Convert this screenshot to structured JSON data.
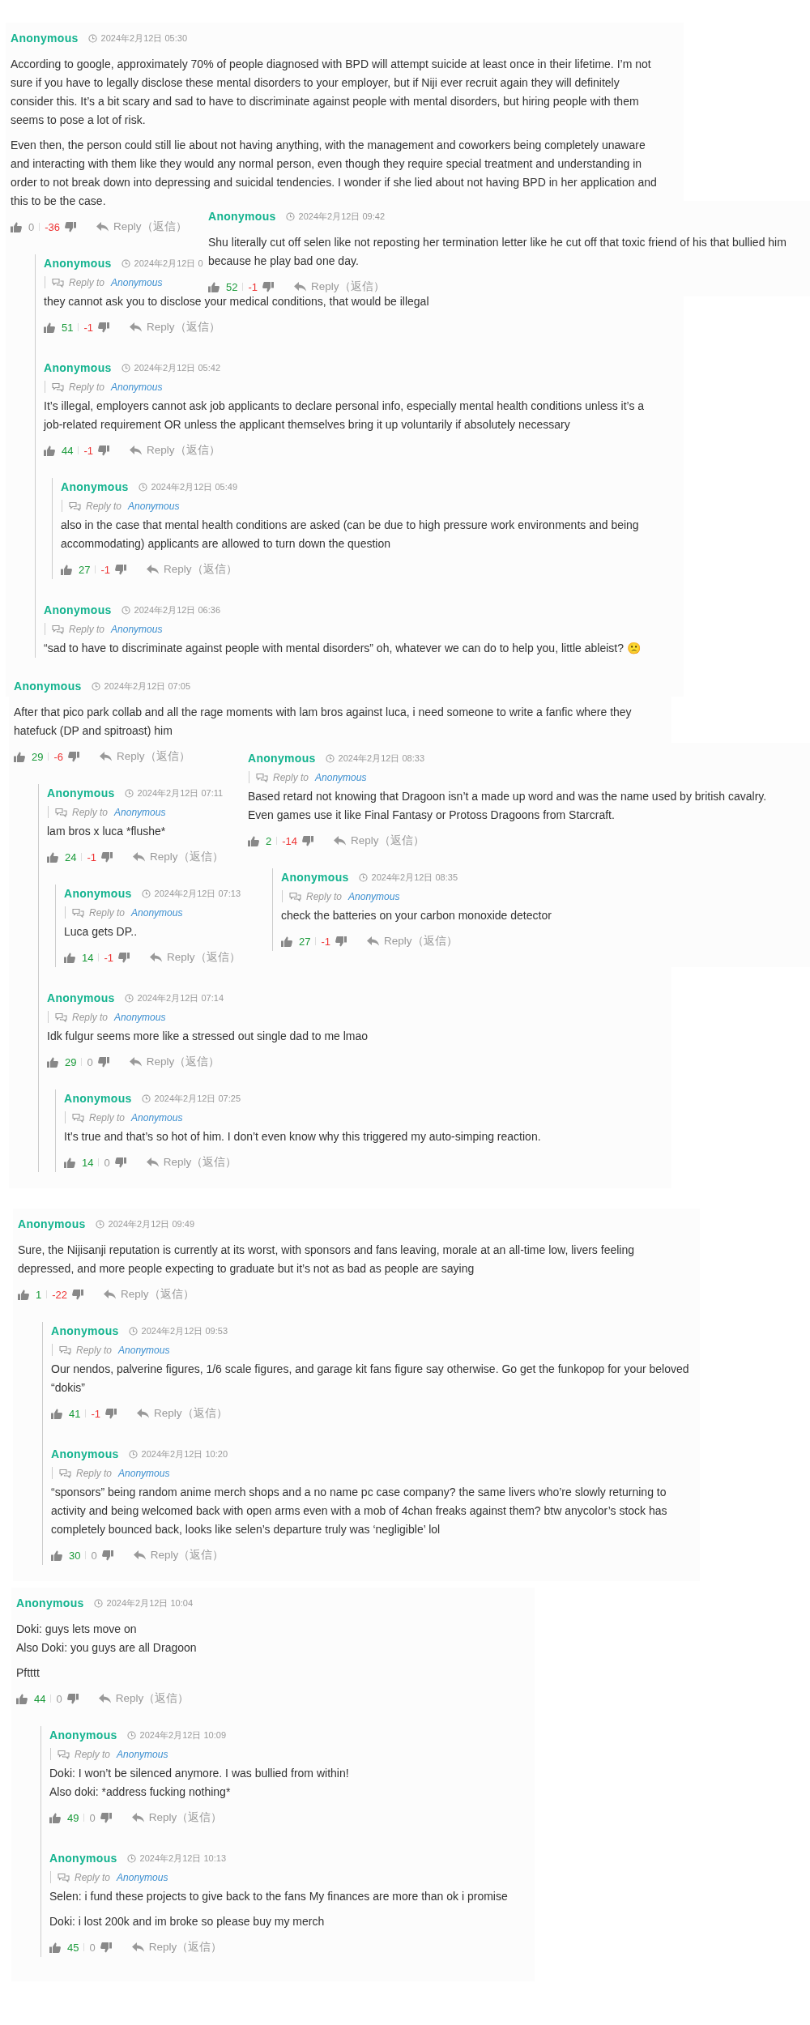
{
  "snippets": [
    {
      "comments": [
        {
          "author": "Anonymous",
          "time": "2024年2月12日 05:30",
          "paragraphs": [
            "According to google, approximately 70% of people diagnosed with BPD will attempt suicide at least once in their lifetime. I’m not sure if you have to legally disclose these mental disorders to your employer, but if Niji ever recruit again they will definitely consider this. It’s a bit scary and sad to have to discriminate against people with mental disorders, but hiring people with them seems to pose a lot of risk.",
            "Even then, the person could still lie about not having anything, with the management and coworkers being completely unaware and interacting with them like they would any normal person, even though they require special treatment and understanding in order to not break down into depressing and suicidal tendencies. I wonder if she lied about not having BPD in her application and this to be the case."
          ],
          "likes": "0",
          "dislikes": "-36",
          "reply_label": "Reply（返信）",
          "replies": [
            {
              "author": "Anonymous",
              "time": "2024年2月12日 0",
              "reply_to_label": "Reply to",
              "reply_to": "Anonymous",
              "paragraphs": [
                "they cannot ask you to disclose your medical conditions, that would be illegal"
              ],
              "likes": "51",
              "dislikes": "-1",
              "reply_label": "Reply（返信）"
            },
            {
              "author": "Anonymous",
              "time": "2024年2月12日 05:42",
              "reply_to_label": "Reply to",
              "reply_to": "Anonymous",
              "paragraphs": [
                "It’s illegal, employers cannot ask job applicants to declare personal info, especially mental health conditions unless it’s a job-related requirement OR unless the applicant themselves bring it up voluntarily if absolutely necessary"
              ],
              "likes": "44",
              "dislikes": "-1",
              "reply_label": "Reply（返信）",
              "replies": [
                {
                  "author": "Anonymous",
                  "time": "2024年2月12日 05:49",
                  "reply_to_label": "Reply to",
                  "reply_to": "Anonymous",
                  "paragraphs": [
                    "also in the case that mental health conditions are asked (can be due to high pressure work environments and being accommodating) applicants are allowed to turn down the question"
                  ],
                  "likes": "27",
                  "dislikes": "-1",
                  "reply_label": "Reply（返信）"
                }
              ]
            },
            {
              "author": "Anonymous",
              "time": "2024年2月12日 06:36",
              "reply_to_label": "Reply to",
              "reply_to": "Anonymous",
              "paragraphs": [
                "“sad to have to discriminate against people with mental disorders” oh, whatever we can do to help you, little ableist? 🙁"
              ]
            }
          ]
        }
      ]
    },
    {
      "comments": [
        {
          "author": "Anonymous",
          "time": "2024年2月12日 09:42",
          "paragraphs": [
            "Shu literally cut off selen like not reposting her termination letter like he cut off that toxic friend of his that bullied him because he play bad one day."
          ],
          "likes": "52",
          "dislikes": "-1",
          "reply_label": "Reply（返信）"
        }
      ]
    },
    {
      "comments": [
        {
          "author": "Anonymous",
          "time": "2024年2月12日 07:05",
          "paragraphs": [
            "After that pico park collab and all the rage moments with lam bros against luca, i need someone to write a fanfic where they hatefuck (DP and spitroast) him"
          ],
          "likes": "29",
          "dislikes": "-6",
          "reply_label": "Reply（返信）",
          "replies": [
            {
              "author": "Anonymous",
              "time": "2024年2月12日 07:11",
              "reply_to_label": "Reply to",
              "reply_to": "Anonymous",
              "paragraphs": [
                "lam bros x luca *flushe*"
              ],
              "likes": "24",
              "dislikes": "-1",
              "reply_label": "Reply（返信）",
              "replies": [
                {
                  "author": "Anonymous",
                  "time": "2024年2月12日 07:13",
                  "reply_to_label": "Reply to",
                  "reply_to": "Anonymous",
                  "paragraphs": [
                    "Luca gets DP.."
                  ],
                  "likes": "14",
                  "dislikes": "-1",
                  "reply_label": "Reply（返信）"
                }
              ]
            },
            {
              "author": "Anonymous",
              "time": "2024年2月12日 07:14",
              "reply_to_label": "Reply to",
              "reply_to": "Anonymous",
              "paragraphs": [
                "Idk fulgur seems more like a stressed out single dad to me lmao"
              ],
              "likes": "29",
              "dislikes": "0",
              "reply_label": "Reply（返信）",
              "replies": [
                {
                  "author": "Anonymous",
                  "time": "2024年2月12日 07:25",
                  "reply_to_label": "Reply to",
                  "reply_to": "Anonymous",
                  "paragraphs": [
                    "It’s true and that’s so hot of him. I don’t even know why this triggered my auto-simping reaction."
                  ],
                  "likes": "14",
                  "dislikes": "0",
                  "reply_label": "Reply（返信）"
                }
              ]
            }
          ]
        }
      ]
    },
    {
      "comments": [
        {
          "author": "Anonymous",
          "time": "2024年2月12日 08:33",
          "reply_to_label": "Reply to",
          "reply_to": "Anonymous",
          "paragraphs": [
            "Based retard not knowing that Dragoon isn’t a made up word and was the name used by british cavalry. Even games use it like Final Fantasy or Protoss Dragoons from Starcraft."
          ],
          "likes": "2",
          "dislikes": "-14",
          "reply_label": "Reply（返信）",
          "replies": [
            {
              "author": "Anonymous",
              "time": "2024年2月12日 08:35",
              "reply_to_label": "Reply to",
              "reply_to": "Anonymous",
              "paragraphs": [
                "check the batteries on your carbon monoxide detector"
              ],
              "likes": "27",
              "dislikes": "-1",
              "reply_label": "Reply（返信）"
            }
          ]
        }
      ]
    },
    {
      "comments": [
        {
          "author": "Anonymous",
          "time": "2024年2月12日 09:49",
          "paragraphs": [
            "Sure, the Nijisanji reputation is currently at its worst, with sponsors and fans leaving, morale at an all-time low, livers feeling depressed, and more people expecting to graduate but it’s not as bad as people are saying"
          ],
          "likes": "1",
          "dislikes": "-22",
          "reply_label": "Reply（返信）",
          "replies": [
            {
              "author": "Anonymous",
              "time": "2024年2月12日 09:53",
              "reply_to_label": "Reply to",
              "reply_to": "Anonymous",
              "paragraphs": [
                "Our nendos, palverine figures, 1/6 scale figures, and garage kit fans figure say otherwise. Go get the funkopop for your beloved “dokis”"
              ],
              "likes": "41",
              "dislikes": "-1",
              "reply_label": "Reply（返信）"
            },
            {
              "author": "Anonymous",
              "time": "2024年2月12日 10:20",
              "reply_to_label": "Reply to",
              "reply_to": "Anonymous",
              "paragraphs": [
                "“sponsors” being random anime merch shops and a no name pc case company? the same livers who’re slowly returning to activity and being welcomed back with open arms even with a mob of 4chan freaks against them? btw anycolor’s stock has completely bounced back, looks like selen’s departure truly was ‘negligible’ lol"
              ],
              "likes": "30",
              "dislikes": "0",
              "reply_label": "Reply（返信）"
            }
          ]
        }
      ]
    },
    {
      "comments": [
        {
          "author": "Anonymous",
          "time": "2024年2月12日 10:04",
          "paragraphs": [
            "Doki: guys lets move on\nAlso Doki: you guys are all Dragoon",
            "Pftttt"
          ],
          "likes": "44",
          "dislikes": "0",
          "reply_label": "Reply（返信）",
          "replies": [
            {
              "author": "Anonymous",
              "time": "2024年2月12日 10:09",
              "reply_to_label": "Reply to",
              "reply_to": "Anonymous",
              "paragraphs": [
                "Doki: I won’t be silenced anymore. I was bullied from within!\nAlso doki: *address fucking nothing*"
              ],
              "likes": "49",
              "dislikes": "0",
              "reply_label": "Reply（返信）"
            },
            {
              "author": "Anonymous",
              "time": "2024年2月12日 10:13",
              "reply_to_label": "Reply to",
              "reply_to": "Anonymous",
              "paragraphs": [
                "Selen: i fund these projects to give back to the fans My finances are more than ok i promise",
                "Doki: i lost 200k and im broke so please buy my merch"
              ],
              "likes": "45",
              "dislikes": "0",
              "reply_label": "Reply（返信）"
            }
          ]
        }
      ]
    }
  ]
}
